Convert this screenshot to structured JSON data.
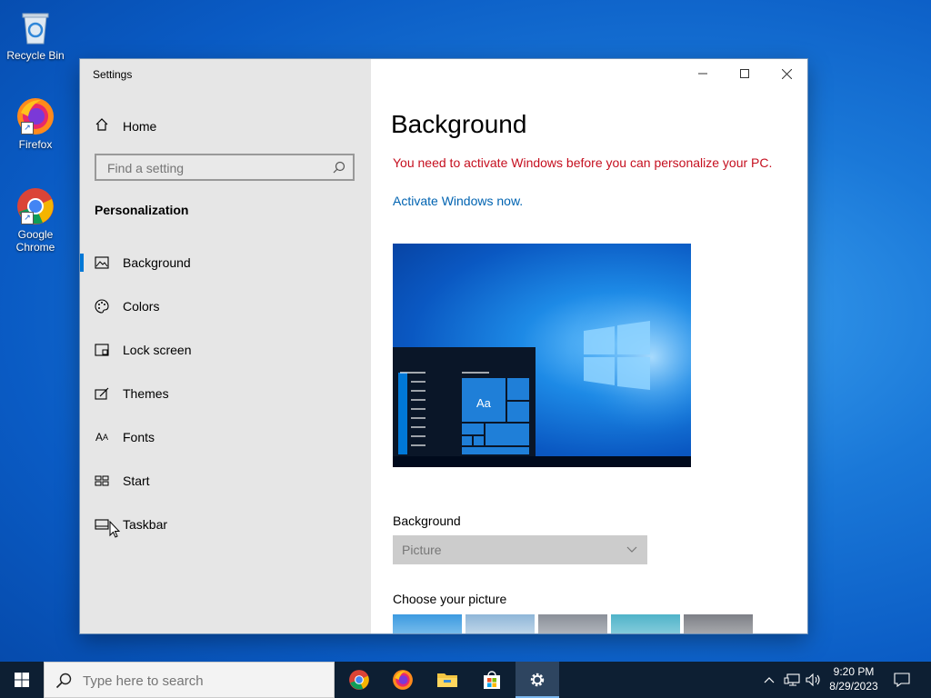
{
  "desktop": {
    "icons": [
      {
        "label": "Recycle Bin"
      },
      {
        "label": "Firefox"
      },
      {
        "label": "Google Chrome"
      }
    ]
  },
  "window": {
    "title": "Settings",
    "sidebar": {
      "home_label": "Home",
      "search_placeholder": "Find a setting",
      "section_title": "Personalization",
      "items": [
        {
          "label": "Background",
          "icon": "picture-icon",
          "active": true
        },
        {
          "label": "Colors",
          "icon": "palette-icon"
        },
        {
          "label": "Lock screen",
          "icon": "lock-screen-icon"
        },
        {
          "label": "Themes",
          "icon": "themes-icon"
        },
        {
          "label": "Fonts",
          "icon": "fonts-icon"
        },
        {
          "label": "Start",
          "icon": "start-icon"
        },
        {
          "label": "Taskbar",
          "icon": "taskbar-icon"
        }
      ]
    },
    "main": {
      "title": "Background",
      "warning": "You need to activate Windows before you can personalize your PC.",
      "activate_link": "Activate Windows now.",
      "preview_tile_text": "Aa",
      "background_label": "Background",
      "background_value": "Picture",
      "choose_label": "Choose your picture"
    }
  },
  "taskbar": {
    "search_placeholder": "Type here to search",
    "time": "9:20 PM",
    "date": "8/29/2023"
  },
  "colors": {
    "accent": "#0078d7",
    "warning": "#c50f1f",
    "link": "#0063b1"
  }
}
